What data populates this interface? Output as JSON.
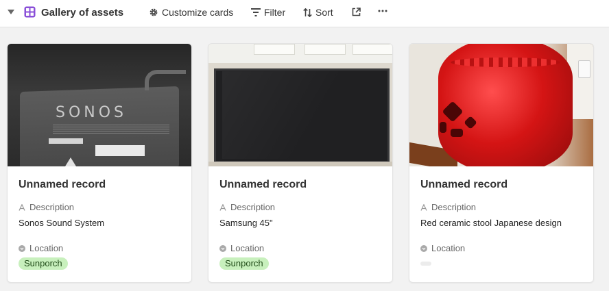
{
  "toolbar": {
    "view_name": "Gallery of assets",
    "customize_label": "Customize cards",
    "filter_label": "Filter",
    "sort_label": "Sort"
  },
  "colors": {
    "view_icon": "#8a4fd8",
    "pill_bg": "#c8f0bd",
    "pill_text": "#1f4a17"
  },
  "cards": [
    {
      "title": "Unnamed record",
      "description_label": "Description",
      "description": "Sonos Sound System",
      "location_label": "Location",
      "location": "Sunporch",
      "photo": "sonos-speaker-photo",
      "photo_text": "SONOS"
    },
    {
      "title": "Unnamed record",
      "description_label": "Description",
      "description": "Samsung 45\"",
      "location_label": "Location",
      "location": "Sunporch",
      "photo": "samsung-tv-photo"
    },
    {
      "title": "Unnamed record",
      "description_label": "Description",
      "description": "Red ceramic stool Japanese design",
      "location_label": "Location",
      "location": "",
      "photo": "red-stool-photo"
    }
  ]
}
